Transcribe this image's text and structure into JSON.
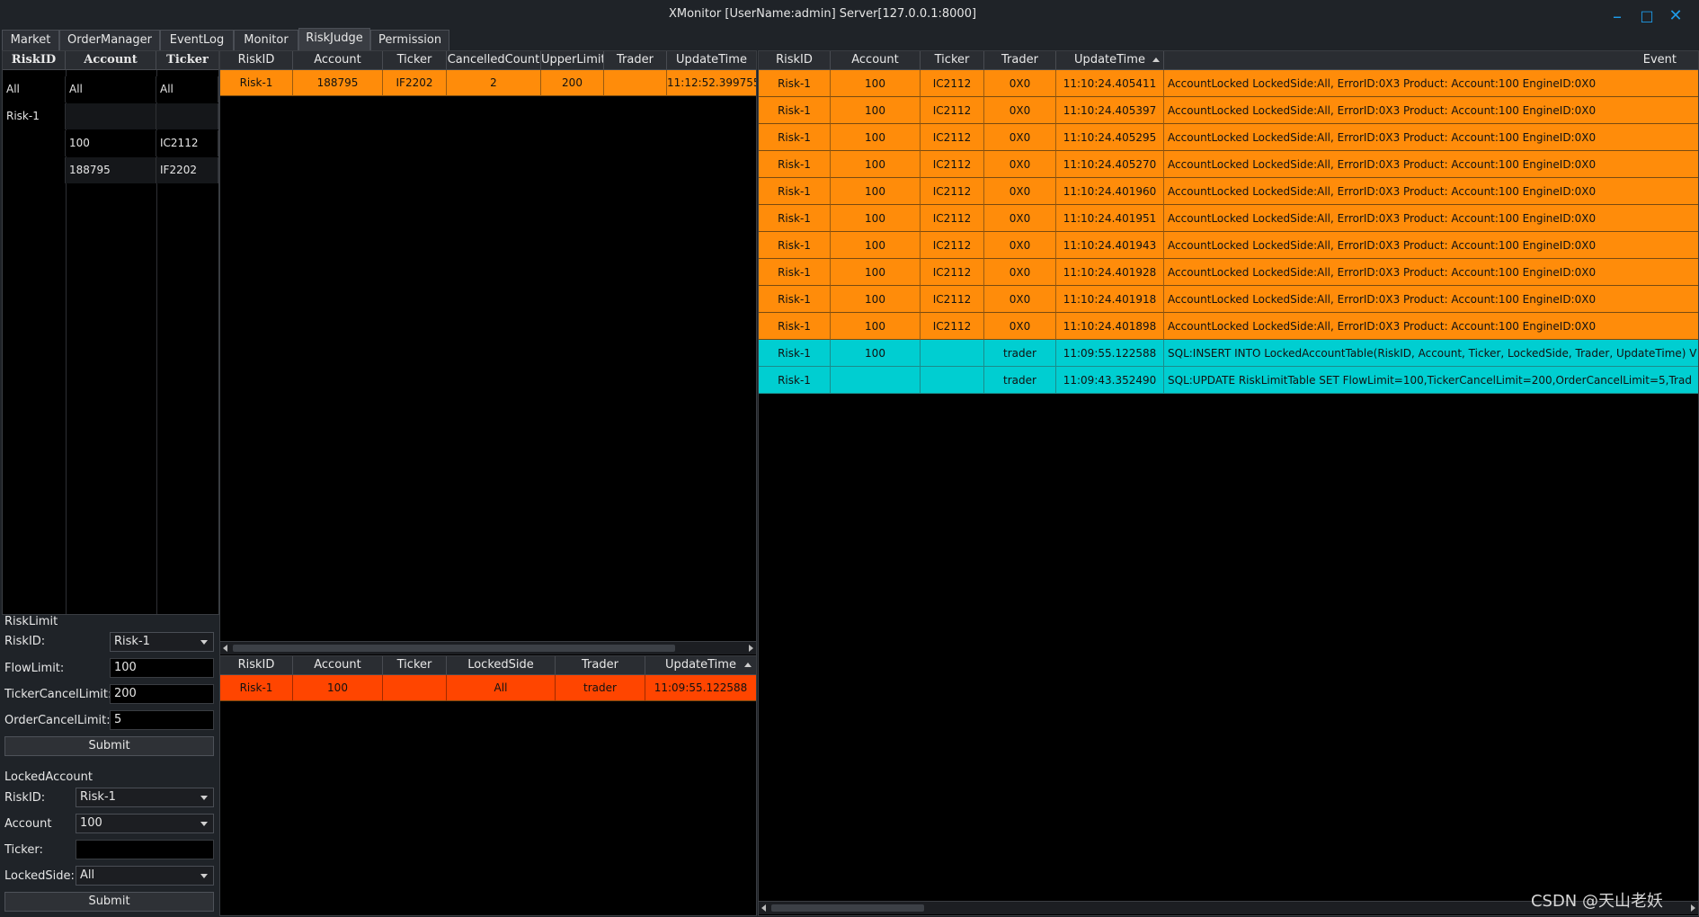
{
  "window": {
    "title": "XMonitor [UserName:admin] Server[127.0.0.1:8000]"
  },
  "tabs": [
    "Market",
    "OrderManager",
    "EventLog",
    "Monitor",
    "RiskJudge",
    "Permission"
  ],
  "tree": {
    "headers": [
      "RiskID",
      "Account",
      "Ticker"
    ],
    "rows": [
      [
        "All",
        "All",
        "All"
      ],
      [
        "Risk-1",
        "",
        ""
      ],
      [
        "",
        "100",
        "IC2112"
      ],
      [
        "",
        "188795",
        "IF2202"
      ]
    ]
  },
  "risk_limit": {
    "section": "RiskLimit",
    "riskid_label": "RiskID:",
    "riskid_value": "Risk-1",
    "flowlimit_label": "FlowLimit:",
    "flowlimit_value": "100",
    "tickercancel_label": "TickerCancelLimit:",
    "tickercancel_value": "200",
    "ordercancel_label": "OrderCancelLimit:",
    "ordercancel_value": "5",
    "submit": "Submit"
  },
  "locked_account": {
    "section": "LockedAccount",
    "riskid_label": "RiskID:",
    "riskid_value": "Risk-1",
    "account_label": "Account",
    "account_value": "100",
    "ticker_label": "Ticker:",
    "ticker_value": "",
    "lockedside_label": "LockedSide:",
    "lockedside_value": "All",
    "submit": "Submit"
  },
  "cancel_table": {
    "headers": [
      "RiskID",
      "Account",
      "Ticker",
      "CancelledCount",
      "UpperLimit",
      "Trader",
      "UpdateTime"
    ],
    "rows": [
      [
        "Risk-1",
        "188795",
        "IF2202",
        "2",
        "200",
        "",
        "11:12:52.399755"
      ]
    ]
  },
  "locked_table": {
    "headers": [
      "RiskID",
      "Account",
      "Ticker",
      "LockedSide",
      "Trader",
      "UpdateTime"
    ],
    "rows": [
      [
        "Risk-1",
        "100",
        "",
        "All",
        "trader",
        "11:09:55.122588"
      ]
    ]
  },
  "event_table": {
    "headers": [
      "RiskID",
      "Account",
      "Ticker",
      "Trader",
      "UpdateTime",
      "Event"
    ],
    "rows": [
      [
        "Risk-1",
        "100",
        "IC2112",
        "0X0",
        "11:10:24.405411",
        "AccountLocked LockedSide:All, ErrorID:0X3 Product: Account:100 EngineID:0X0"
      ],
      [
        "Risk-1",
        "100",
        "IC2112",
        "0X0",
        "11:10:24.405397",
        "AccountLocked LockedSide:All, ErrorID:0X3 Product: Account:100 EngineID:0X0"
      ],
      [
        "Risk-1",
        "100",
        "IC2112",
        "0X0",
        "11:10:24.405295",
        "AccountLocked LockedSide:All, ErrorID:0X3 Product: Account:100 EngineID:0X0"
      ],
      [
        "Risk-1",
        "100",
        "IC2112",
        "0X0",
        "11:10:24.405270",
        "AccountLocked LockedSide:All, ErrorID:0X3 Product: Account:100 EngineID:0X0"
      ],
      [
        "Risk-1",
        "100",
        "IC2112",
        "0X0",
        "11:10:24.401960",
        "AccountLocked LockedSide:All, ErrorID:0X3 Product: Account:100 EngineID:0X0"
      ],
      [
        "Risk-1",
        "100",
        "IC2112",
        "0X0",
        "11:10:24.401951",
        "AccountLocked LockedSide:All, ErrorID:0X3 Product: Account:100 EngineID:0X0"
      ],
      [
        "Risk-1",
        "100",
        "IC2112",
        "0X0",
        "11:10:24.401943",
        "AccountLocked LockedSide:All, ErrorID:0X3 Product: Account:100 EngineID:0X0"
      ],
      [
        "Risk-1",
        "100",
        "IC2112",
        "0X0",
        "11:10:24.401928",
        "AccountLocked LockedSide:All, ErrorID:0X3 Product: Account:100 EngineID:0X0"
      ],
      [
        "Risk-1",
        "100",
        "IC2112",
        "0X0",
        "11:10:24.401918",
        "AccountLocked LockedSide:All, ErrorID:0X3 Product: Account:100 EngineID:0X0"
      ],
      [
        "Risk-1",
        "100",
        "IC2112",
        "0X0",
        "11:10:24.401898",
        "AccountLocked LockedSide:All, ErrorID:0X3 Product: Account:100 EngineID:0X0"
      ],
      [
        "Risk-1",
        "100",
        "",
        "trader",
        "11:09:55.122588",
        "SQL:INSERT INTO LockedAccountTable(RiskID, Account, Ticker, LockedSide, Trader, UpdateTime) V"
      ],
      [
        "Risk-1",
        "",
        "",
        "trader",
        "11:09:43.352490",
        "SQL:UPDATE RiskLimitTable SET FlowLimit=100,TickerCancelLimit=200,OrderCancelLimit=5,Trad"
      ]
    ],
    "row_kinds": [
      "orange",
      "orange",
      "orange",
      "orange",
      "orange",
      "orange",
      "orange",
      "orange",
      "orange",
      "orange",
      "cyan",
      "cyan"
    ]
  },
  "colors": {
    "orange": "#ff8c0a",
    "cyan": "#00ced1",
    "red": "#ff4500",
    "accent": "#1e9be8"
  },
  "watermark": "CSDN @天山老妖"
}
